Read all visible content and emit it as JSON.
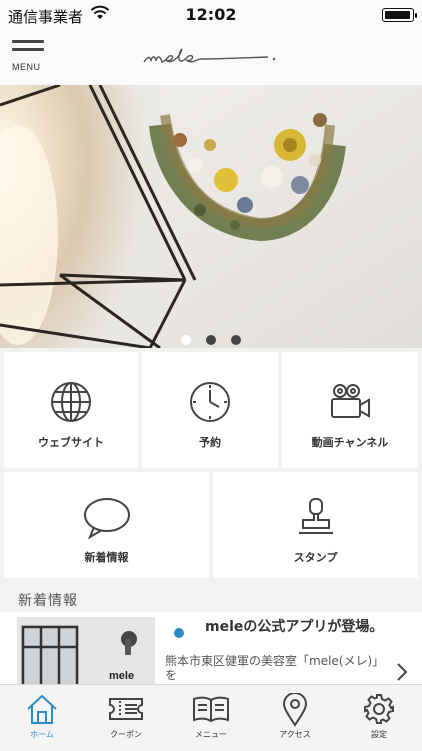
{
  "status": {
    "carrier": "通信事業者",
    "time": "12:02"
  },
  "header": {
    "menu_label": "MENU",
    "logo_text": "mele"
  },
  "carousel": {
    "pages": 3,
    "active_index": 0
  },
  "tiles": [
    {
      "label": "ウェブサイト",
      "icon": "globe-icon"
    },
    {
      "label": "予約",
      "icon": "clock-icon"
    },
    {
      "label": "動画チャンネル",
      "icon": "video-camera-icon"
    },
    {
      "label": "新着情報",
      "icon": "speech-bubble-icon"
    },
    {
      "label": "スタンプ",
      "icon": "stamp-icon"
    }
  ],
  "news": {
    "heading": "新着情報",
    "items": [
      {
        "title": "meleの公式アプリが登場。",
        "desc": "熊本市東区健軍の美容室「mele(メレ)」を",
        "thumb_text": "mele"
      }
    ]
  },
  "tabbar": {
    "items": [
      {
        "label": "ホーム",
        "icon": "home-icon",
        "active": true
      },
      {
        "label": "クーポン",
        "icon": "coupon-icon",
        "active": false
      },
      {
        "label": "メニュー",
        "icon": "menu-book-icon",
        "active": false
      },
      {
        "label": "アクセス",
        "icon": "map-pin-icon",
        "active": false
      },
      {
        "label": "設定",
        "icon": "gear-icon",
        "active": false
      }
    ]
  },
  "colors": {
    "accent": "#2e8bc9",
    "background": "#f2f2f0",
    "tile": "#ffffff"
  }
}
